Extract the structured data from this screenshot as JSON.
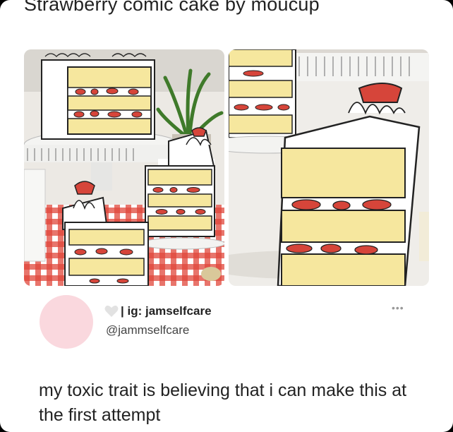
{
  "meme": {
    "caption": "Strawberry comic cake by moucup"
  },
  "photos": [
    {
      "icon": "comic-cake-photo-left"
    },
    {
      "icon": "comic-cake-photo-right"
    }
  ],
  "post": {
    "display_name": "| ig: jamselfcare",
    "handle": "@jammselfcare",
    "more_icon": "•••",
    "text": "my toxic trait is believing that i can make this at the first attempt",
    "avatar_color": "#fad8de"
  },
  "colors": {
    "sponge": "#f6e79e",
    "strawberry": "#d6453a",
    "tablecloth": "#e0473a"
  }
}
